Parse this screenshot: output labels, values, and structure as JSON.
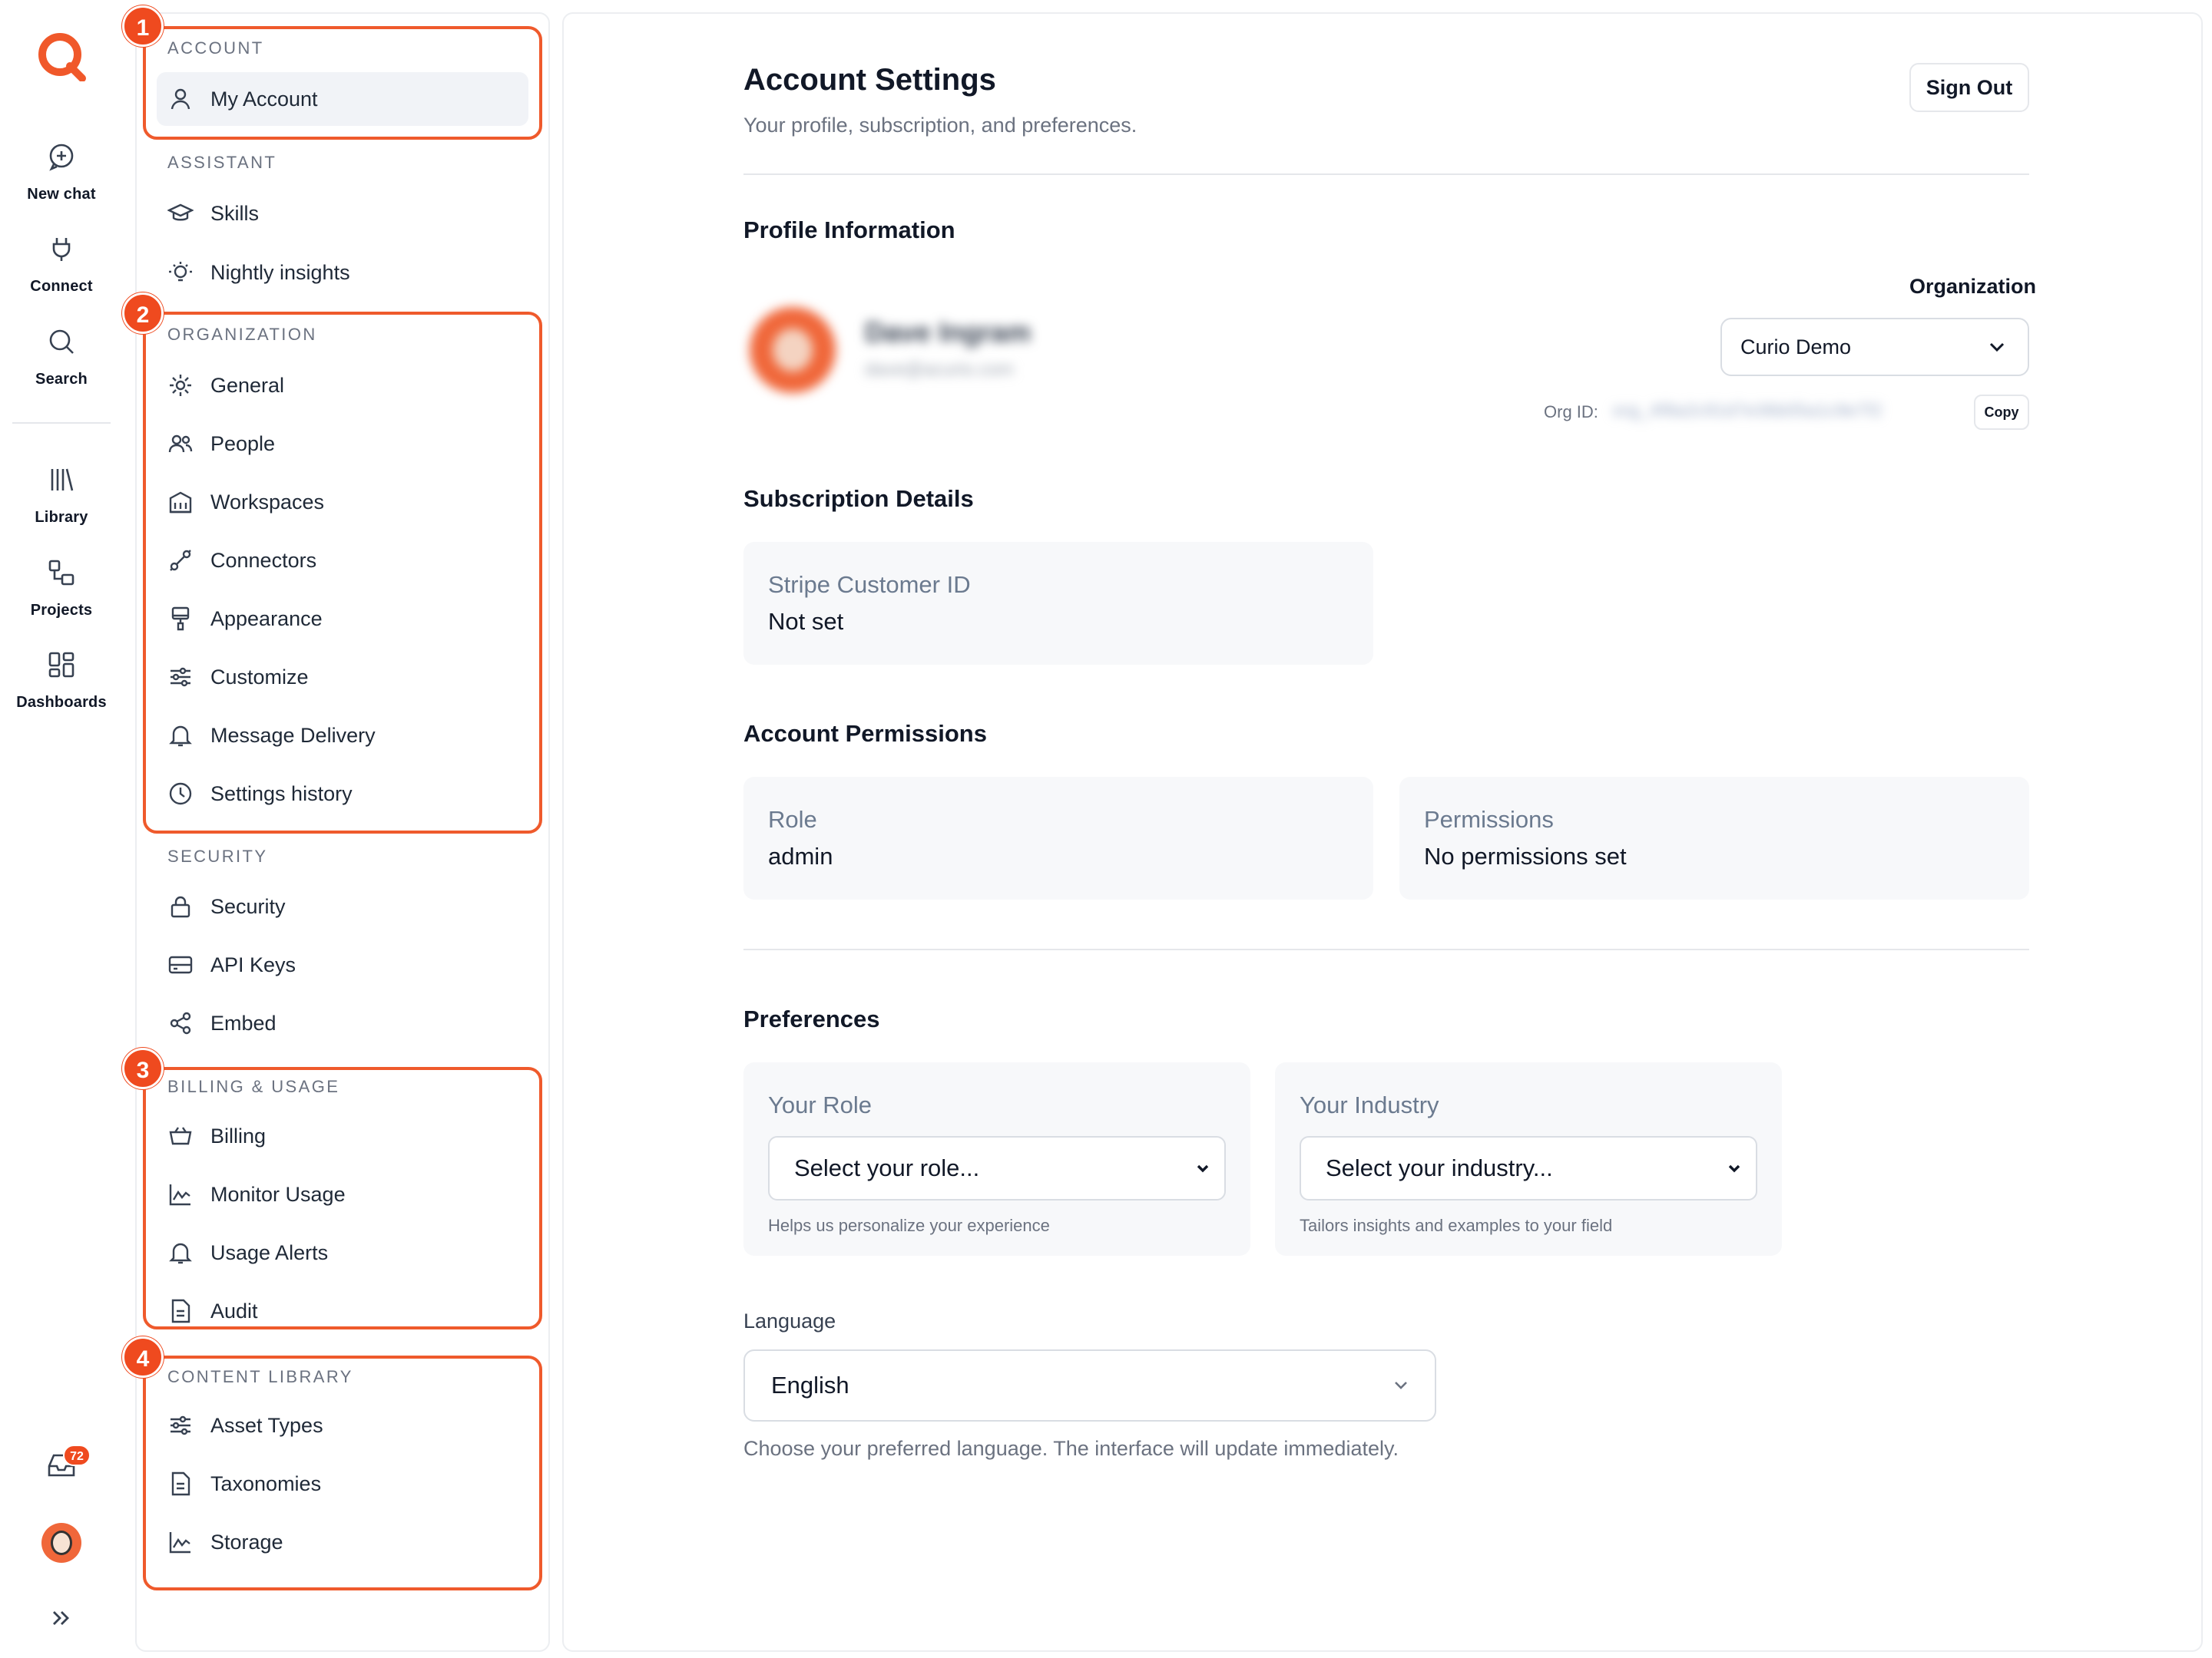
{
  "rail": {
    "items": [
      {
        "label": "New chat",
        "icon": "chat-plus-icon"
      },
      {
        "label": "Connect",
        "icon": "plug-icon"
      },
      {
        "label": "Search",
        "icon": "search-icon"
      },
      {
        "label": "Library",
        "icon": "library-icon"
      },
      {
        "label": "Projects",
        "icon": "projects-icon"
      },
      {
        "label": "Dashboards",
        "icon": "dashboards-icon"
      }
    ],
    "inbox_badge": "72"
  },
  "nav": {
    "sections": {
      "account": "ACCOUNT",
      "assistant": "ASSISTANT",
      "organization": "ORGANIZATION",
      "security": "SECURITY",
      "billing": "BILLING & USAGE",
      "content": "CONTENT LIBRARY"
    },
    "items": {
      "my_account": "My Account",
      "skills": "Skills",
      "nightly_insights": "Nightly insights",
      "general": "General",
      "people": "People",
      "workspaces": "Workspaces",
      "connectors": "Connectors",
      "appearance": "Appearance",
      "customize": "Customize",
      "message_delivery": "Message Delivery",
      "settings_history": "Settings history",
      "security": "Security",
      "api_keys": "API Keys",
      "embed": "Embed",
      "billing": "Billing",
      "monitor_usage": "Monitor Usage",
      "usage_alerts": "Usage Alerts",
      "audit": "Audit",
      "asset_types": "Asset Types",
      "taxonomies": "Taxonomies",
      "storage": "Storage"
    },
    "markers": [
      "1",
      "2",
      "3",
      "4"
    ]
  },
  "main": {
    "title": "Account Settings",
    "subtitle": "Your profile, subscription, and preferences.",
    "sign_out": "Sign Out",
    "profile": {
      "heading": "Profile Information",
      "name": "Dave Ingram",
      "email": "dave@acurio.com",
      "org_label": "Organization",
      "org_value": "Curio Demo",
      "org_id_label": "Org ID:",
      "org_id_value": "org_4f8a2c91d7e36b05a1c9e7f2",
      "copy": "Copy"
    },
    "subscription": {
      "heading": "Subscription Details",
      "stripe_label": "Stripe Customer ID",
      "stripe_value": "Not set"
    },
    "permissions": {
      "heading": "Account Permissions",
      "role_label": "Role",
      "role_value": "admin",
      "perm_label": "Permissions",
      "perm_value": "No permissions set"
    },
    "preferences": {
      "heading": "Preferences",
      "role_label": "Your Role",
      "role_placeholder": "Select your role...",
      "role_hint": "Helps us personalize your experience",
      "industry_label": "Your Industry",
      "industry_placeholder": "Select your industry...",
      "industry_hint": "Tailors insights and examples to your field",
      "language_label": "Language",
      "language_value": "English",
      "language_hint": "Choose your preferred language. The interface will update immediately."
    }
  },
  "colors": {
    "accent": "#ef4a1f",
    "card": "#f7f8fa",
    "muted": "#6b7280"
  }
}
